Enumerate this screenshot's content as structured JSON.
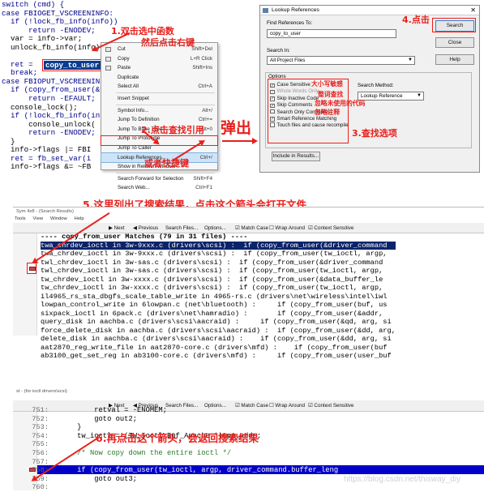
{
  "colors": {
    "annotation_red": "#e8201c",
    "selection_blue": "#0a3d91",
    "keyword_blue": "#00008b",
    "result_selected": "#0a246a",
    "highlight_cursor": "#0000c8",
    "gutter_mark": "#c84b4b"
  },
  "panel1": {
    "code_lines": [
      "switch (cmd) {",
      "case FBIOGET_VSCREENINFO:",
      "  if (!lock_fb_info(info))",
      "      return -ENODEV;",
      "  var = info->var;",
      "  unlock_fb_info(info);",
      "",
      "  ret = ",
      "  break;",
      "case FBIOPUT_VSCREENINFO:",
      "  if (copy_from_user(&va",
      "      return -EFAULT;",
      "  console_lock();",
      "  if (!lock_fb_info(inf",
      "      console_unlock(",
      "      return -ENODEV;",
      "  }",
      "  info->flags |= FBI",
      "  ret = fb_set_var(i",
      "  info->flags &= ~FB"
    ],
    "selected_word": "copy_to_user",
    "context_menu": [
      {
        "label": "Cut",
        "shortcut": "Shift+Del",
        "icon": "scissors-icon"
      },
      {
        "label": "Copy",
        "shortcut": "L+R Click",
        "icon": "copy-icon"
      },
      {
        "label": "Paste",
        "shortcut": "Shift+Ins",
        "icon": "paste-icon"
      },
      {
        "label": "Duplicate",
        "shortcut": ""
      },
      {
        "label": "Select All",
        "shortcut": "Ctrl+A"
      },
      {
        "sep": true
      },
      {
        "label": "Insert Snippet",
        "shortcut": ""
      },
      {
        "sep": true
      },
      {
        "label": "Symbol Info...",
        "shortcut": "Alt+/"
      },
      {
        "label": "Jump To Definition",
        "shortcut": "Ctrl+="
      },
      {
        "label": "Jump To Base Type",
        "shortcut": "Alt+0"
      },
      {
        "label": "Jump To Prototype",
        "shortcut": ""
      },
      {
        "label": "Jump To Caller",
        "shortcut": ""
      },
      {
        "label": "Lookup References...",
        "shortcut": "Ctrl+/",
        "highlight": true
      },
      {
        "label": "Show in Relation Window",
        "shortcut": ""
      },
      {
        "sep": true
      },
      {
        "label": "Search Forward for Selection",
        "shortcut": "Shift+F4"
      },
      {
        "label": "Search Web...",
        "shortcut": "Ctrl+F1"
      }
    ],
    "annotations": {
      "a1_line1": "1.双击选中函数",
      "a1_line2": "然后点击右键",
      "a2": "2.点击查找引用",
      "a3": "或者快捷键"
    }
  },
  "middle_label": "弹出",
  "dialog": {
    "title": "Lookup References",
    "find_label": "Find References To:",
    "find_value": "copy_to_user",
    "search_in_label": "Search In:",
    "search_in_value": "All Project Files",
    "options_label": "Options",
    "options": [
      {
        "label": "Case Sensitive",
        "checked": true
      },
      {
        "label": "Whole Words Only",
        "checked": true,
        "disabled": true
      },
      {
        "label": "Skip Inactive Code",
        "checked": true
      },
      {
        "label": "Skip Comments",
        "checked": true
      },
      {
        "label": "Search Only Comments",
        "checked": false
      },
      {
        "label": "Smart Reference Matching",
        "checked": true
      },
      {
        "label": "Touch files and cause recompile",
        "checked": false
      }
    ],
    "search_method_label": "Search Method:",
    "search_method_value": "Lookup Reference",
    "buttons": {
      "search": "Search",
      "close": "Close",
      "help": "Help",
      "include": "Include in Results..."
    },
    "annotations": {
      "a4": "4.点击",
      "case": "大小写敏感",
      "whole": "整词查找",
      "inactive": "忽略未使用的代码",
      "comments": "忽略注释",
      "a3": "3.查找选项"
    }
  },
  "panel2": {
    "annotation": "5.这里列出了搜索结果，点击这个箭头会打开文件",
    "title_text": "Sym 4x8 - (Search Results)",
    "menu": [
      "Tools",
      "View",
      "Window",
      "Help"
    ],
    "toolbar": {
      "next": "Next",
      "previous": "Previous",
      "search_files": "Search Files...",
      "options": "Options...",
      "match_case": "Match Case",
      "wrap_around": "Wrap Around",
      "context_sensitive": "Context Sensitive"
    },
    "results": [
      "---- copy_from_user Matches (79 in 31 files) ----",
      "twa_chrdev_ioctl in 3w-9xxx.c (drivers\\scsi) :  if (copy_from_user(&driver_command",
      "twa_chrdev_ioctl in 3w-9xxx.c (drivers\\scsi) :  if (copy_from_user(tw_ioctl, argp,",
      "twl_chrdev_ioctl in 3w-sas.c (drivers\\scsi) :  if (copy_from_user(&driver_command",
      "twl_chrdev_ioctl in 3w-sas.c (drivers\\scsi) :  if (copy_from_user(tw_ioctl, argp,",
      "tw_chrdev_ioctl in 3w-xxxx.c (drivers\\scsi) :  if (copy_from_user(&data_buffer_le",
      "tw_chrdev_ioctl in 3w-xxxx.c (drivers\\scsi) :  if (copy_from_user(tw_ioctl, argp,",
      "il4965_rs_sta_dbgfs_scale_table_write in 4965-rs.c (drivers\\net\\wireless\\intel\\iwl",
      "lowpan_control_write in 6lowpan.c (net\\bluetooth) :     if (copy_from_user(buf, us",
      "sixpack_ioctl in 6pack.c (drivers\\net\\hamradio) :       if (copy_from_user(&addr,",
      "query_disk in aachba.c (drivers\\scsi\\aacraid) :     if (copy_from_user(&qd, arg, si",
      "force_delete_disk in aachba.c (drivers\\scsi\\aacraid) :  if (copy_from_user(&dd, arg,",
      "delete_disk in aachba.c (drivers\\scsi\\aacraid) :    if (copy_from_user(&dd, arg, si",
      "aat2870_reg_write_file in aat2870-core.c (drivers\\mfd) :    if (copy_from_user(buf",
      "ab3100_get_set_reg in ab3100-core.c (drivers\\mfd) :     if (copy_from_user(user_buf"
    ]
  },
  "panel3": {
    "annotation": "6.再点击这个箭头，会返回搜索结果",
    "title_text": "st - (for ioctl drivers\\scsi)",
    "toolbar": {
      "next": "Next",
      "previous": "Previous",
      "search_files": "Search Files...",
      "options": "Options...",
      "match_case": "Match Case",
      "wrap_around": "Wrap Around",
      "context_sensitive": "Context Sensitive"
    },
    "lines": [
      {
        "n": "751:",
        "t": "        retval = -ENOMEM;"
      },
      {
        "n": "752:",
        "t": "        goto out2;"
      },
      {
        "n": "753:",
        "t": "    }"
      },
      {
        "n": "754:",
        "t": "    tw_ioctl = (TW_Ioctl_Buf_Apache *)cpu_addr;"
      },
      {
        "n": "755:",
        "t": ""
      },
      {
        "n": "756:",
        "t": "    /* Now copy down the entire ioctl */"
      },
      {
        "n": "757:",
        "t": ""
      },
      {
        "n": "758:",
        "t": "    if (copy_from_user(tw_ioctl, argp, driver_command.buffer_leng"
      },
      {
        "n": "759:",
        "t": "        goto out3;"
      },
      {
        "n": "760:",
        "t": ""
      }
    ],
    "watermark": "https://blog.csdn.net/thisway_diy"
  }
}
